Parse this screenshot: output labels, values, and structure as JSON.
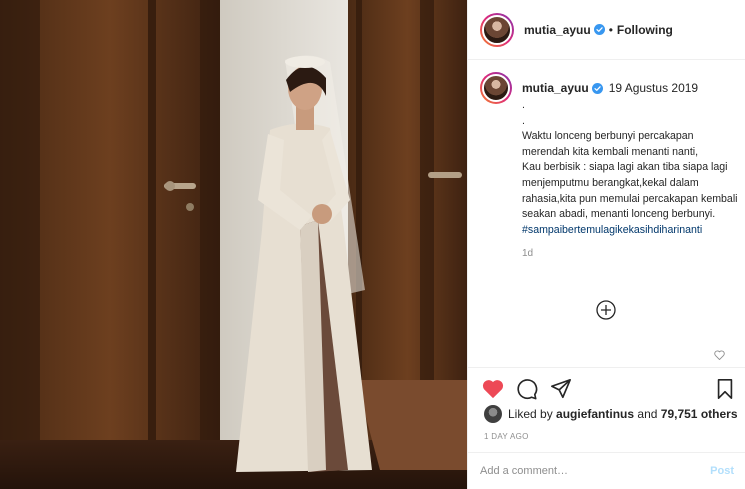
{
  "post": {
    "username": "mutia_ayuu",
    "follow_status": "Following",
    "separator": "•"
  },
  "caption": {
    "username": "mutia_ayuu",
    "date": "19 Agustus 2019",
    "text": ".\n.\nWaktu lonceng berbunyi percakapan merendah kita kembali menanti nanti,\nKau berbisik : siapa lagi akan tiba siapa lagi menjemputmu berangkat,kekal dalam rahasia,kita pun memulai percakapan kembali seakan abadi, menanti lonceng berbunyi.",
    "hashtag": "#sampaibertemulagikekasihdiharinanti",
    "time": "1d"
  },
  "likes": {
    "prefix": "Liked by",
    "user": "augiefantinus",
    "conjunction": "and",
    "count": "79,751 others"
  },
  "timestamp": "1 DAY AGO",
  "comment": {
    "placeholder": "Add a comment…",
    "post_label": "Post"
  },
  "icons": {
    "like": "heart-filled-icon",
    "comment": "comment-bubble-icon",
    "share": "paper-plane-icon",
    "save": "bookmark-icon",
    "load_more": "plus-circle-icon",
    "verified": "verified-badge-icon"
  },
  "colors": {
    "like_red": "#ed4956",
    "verified_blue": "#3897f0",
    "hashtag": "#00376b",
    "muted": "#8e8e8e",
    "post_disabled": "#b2dffc"
  }
}
